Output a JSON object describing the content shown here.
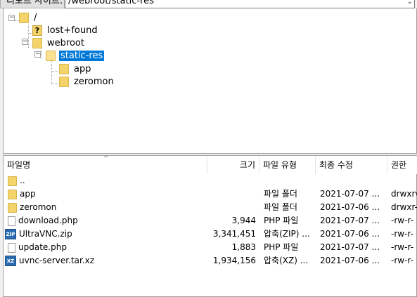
{
  "pathbar": {
    "label": "리모트 사이트:",
    "path": "/webroot/static-res"
  },
  "tree": {
    "nodes": [
      {
        "label": "/",
        "icon": "folder-icon"
      },
      {
        "label": "lost+found",
        "icon": "question-folder-icon"
      },
      {
        "label": "webroot",
        "icon": "folder-icon"
      },
      {
        "label": "static-res",
        "icon": "folder-open-icon",
        "selected": true
      },
      {
        "label": "app",
        "icon": "folder-icon"
      },
      {
        "label": "zeromon",
        "icon": "folder-icon"
      }
    ]
  },
  "list": {
    "columns": [
      "파일명",
      "크기",
      "파일 유형",
      "최종 수정",
      "권한"
    ],
    "rows": [
      {
        "name": "..",
        "size": "",
        "type": "",
        "modified": "",
        "perm": "",
        "icon": "folder-icon"
      },
      {
        "name": "app",
        "size": "",
        "type": "파일 폴더",
        "modified": "2021-07-07 ...",
        "perm": "drwxrv",
        "icon": "folder-icon"
      },
      {
        "name": "zeromon",
        "size": "",
        "type": "파일 폴더",
        "modified": "2021-07-06 ...",
        "perm": "drwxr-",
        "icon": "folder-icon"
      },
      {
        "name": "download.php",
        "size": "3,944",
        "type": "PHP 파일",
        "modified": "2021-07-07 ...",
        "perm": "-rw-r-",
        "icon": "document-icon"
      },
      {
        "name": "UltraVNC.zip",
        "size": "3,341,451",
        "type": "압축(ZIP) ...",
        "modified": "2021-07-06 ...",
        "perm": "-rw-r-",
        "icon": "zip-icon"
      },
      {
        "name": "update.php",
        "size": "1,883",
        "type": "PHP 파일",
        "modified": "2021-07-07 ...",
        "perm": "-rw-r-",
        "icon": "document-icon"
      },
      {
        "name": "uvnc-server.tar.xz",
        "size": "1,934,156",
        "type": "압축(XZ) ...",
        "modified": "2021-07-06 ...",
        "perm": "-rw-r-",
        "icon": "xz-icon"
      }
    ]
  },
  "icons": {
    "zip_text": "ZIP",
    "xz_text": "XZ",
    "question_text": "?",
    "expand_minus": "−",
    "chevron": "⌄"
  },
  "colors": {
    "selection": "#0078d7",
    "folder": "#f4d36a"
  }
}
